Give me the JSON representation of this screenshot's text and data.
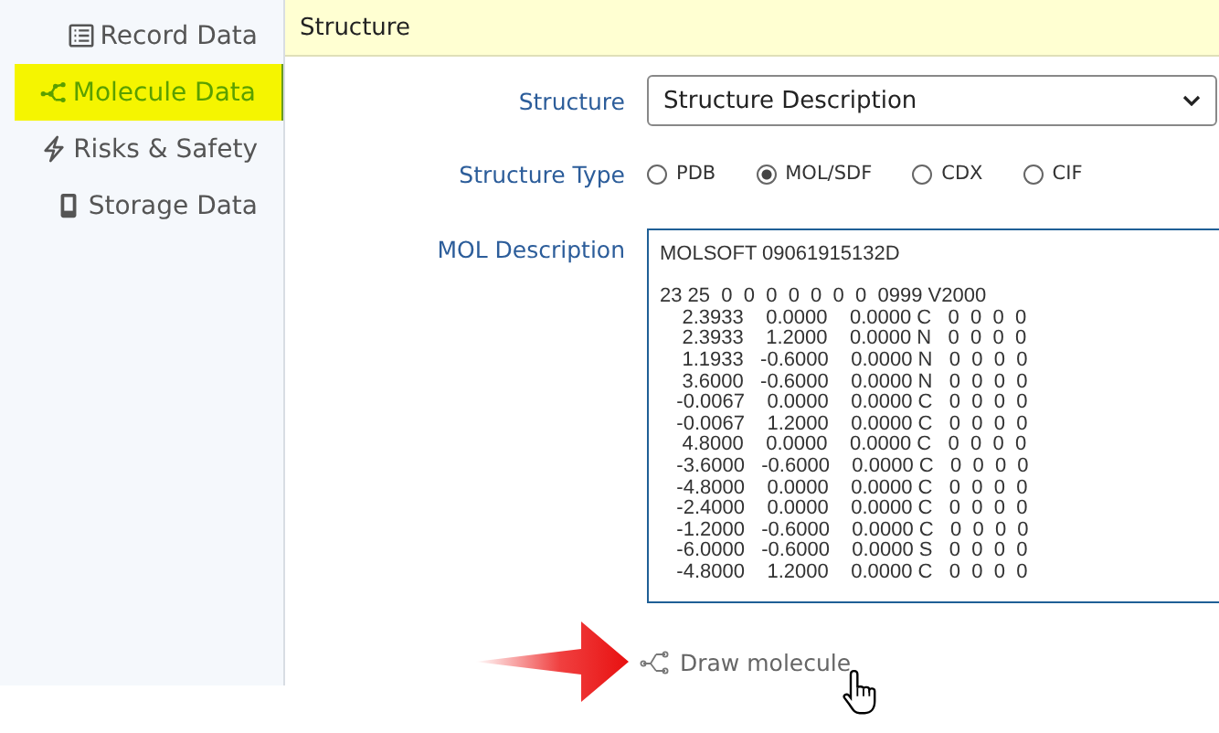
{
  "sidebar": {
    "items": [
      {
        "label": "Record Data",
        "selected": false
      },
      {
        "label": "Molecule Data",
        "selected": true
      },
      {
        "label": "Risks & Safety",
        "selected": false
      },
      {
        "label": "Storage Data",
        "selected": false
      }
    ]
  },
  "section": {
    "title": "Structure"
  },
  "form": {
    "structure": {
      "label": "Structure",
      "value": "Structure Description"
    },
    "structure_type": {
      "label": "Structure Type",
      "options": [
        {
          "label": "PDB",
          "selected": false
        },
        {
          "label": "MOL/SDF",
          "selected": true
        },
        {
          "label": "CDX",
          "selected": false
        },
        {
          "label": "CIF",
          "selected": false
        }
      ]
    },
    "mol_description": {
      "label": "MOL Description",
      "value": "MOLSOFT 09061915132D\n\n23 25  0  0  0  0  0  0  0  0999 V2000\n    2.3933    0.0000    0.0000 C   0  0  0  0\n    2.3933    1.2000    0.0000 N   0  0  0  0\n    1.1933   -0.6000    0.0000 N   0  0  0  0\n    3.6000   -0.6000    0.0000 N   0  0  0  0\n   -0.0067    0.0000    0.0000 C   0  0  0  0\n   -0.0067    1.2000    0.0000 C   0  0  0  0\n    4.8000    0.0000    0.0000 C   0  0  0  0\n   -3.6000   -0.6000    0.0000 C   0  0  0  0\n   -4.8000    0.0000    0.0000 C   0  0  0  0\n   -2.4000    0.0000    0.0000 C   0  0  0  0\n   -1.2000   -0.6000    0.0000 C   0  0  0  0\n   -6.0000   -0.6000    0.0000 S   0  0  0  0\n   -4.8000    1.2000    0.0000 C   0  0  0  0"
    },
    "draw_link": {
      "label": "Draw molecule"
    }
  }
}
